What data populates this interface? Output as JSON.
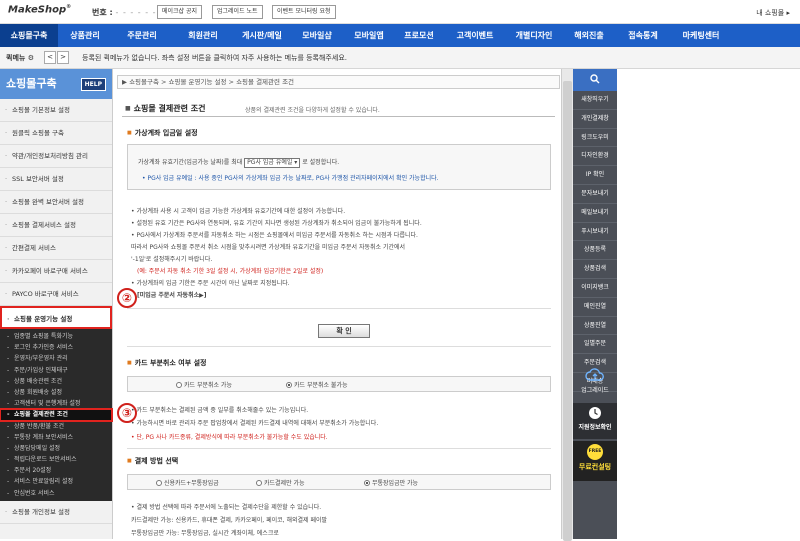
{
  "topbar": {
    "logo": "MakeShop",
    "logo_mark": "®",
    "shop_no_label": "번호 :",
    "shop_no_dots": "- - - - - - -",
    "buttons": [
      "메이크샵 공지",
      "업그레이드 노트",
      "이벤트 모니터링 요청"
    ],
    "my_mall": "내 쇼핑몰 ▸"
  },
  "nav": {
    "items": [
      "쇼핑몰구축",
      "상품관리",
      "주문관리",
      "회원관리",
      "게시판/메일",
      "모바일샵",
      "모바일앱",
      "프로모션",
      "고객이벤트",
      "개별디자인",
      "해외진출",
      "접속통계",
      "마케팅센터"
    ],
    "active_index": 0
  },
  "quickbar": {
    "label": "퀵메뉴",
    "text": "등록된 퀵메뉴가 없습니다. 좌측 설정 버튼을 클릭하여 자주 사용하는 메뉴를 등록해주세요."
  },
  "sidebar": {
    "header": "쇼핑몰구축",
    "help": "HELP",
    "items": [
      "쇼핑몰 기본정보 설정",
      "원클릭 쇼핑몰 구축",
      "약관/개인정보처리방침 관리",
      "SSL 보안서버 설정",
      "쇼핑몰 완벽 보안서버 설정",
      "쇼핑몰 결제서비스 설정",
      "간편결제 서비스",
      "카카오페이 바로구매 서비스",
      "PAYCO 바로구매 서비스",
      "쇼핑몰 운영기능 설정"
    ],
    "sub_items": [
      "업종별 쇼핑몰 특화기능",
      "로그인 추가인증 서비스",
      "운영자/부운영자 관리",
      "주문/가입상 인체태구",
      "상품 배송관련 조건",
      "상품 회원배송 설정",
      "고객센터 및 은행계좌 설정",
      "쇼핑몰 결제관련 조건",
      "상품 반품/환불 조건",
      "무통장 계좌 보안서비스",
      "상품담당메일 설정",
      "적립다운로드 보안서비스",
      "주문서 20설정",
      "서비스 만료알림리 설정",
      "안심번호 서비스"
    ],
    "active_sub_index": 7,
    "next_item": "쇼핑몰 개인정보 설정"
  },
  "breadcrumb": "▶ 쇼핑몰구축 > 쇼핑몰 운영기능 설정 > 쇼핑몰 결제관련 조건",
  "page": {
    "title": "쇼핑몰 결제관련 조건",
    "desc": "상품의 결제관련 조건을 다양하게 설정할 수 있습니다.",
    "section1": {
      "title": "가상계좌 입금일 설정",
      "line1_pre": "가상계좌 유효기간(입금가능 날짜)를 최대",
      "select_value": "PG사 입금 유예일",
      "line1_post": "로 설정합니다.",
      "note": "• PG사 입금 유예일 : 사용 중인 PG사의 가상계좌 입금 가능 날짜로, PG사 가맹점 관리자페이지에서 확인 가능합니다.",
      "bullets": [
        "• 가상계좌 사용 시 고객이 입금 가능한 가상계좌 유효기간에 대한 설정이 가능합니다.",
        "• 설정된 유효 기간은 PG사와 연동되며, 유효 기간이 지나면 생성된 가상계좌가 취소되어 입금이 불가능하게 됩니다.",
        "• PG사에서 가상계좌 주문서를 자동취소 하는 시점은 쇼핑몰에서 미입금 주문서를 자동취소 하는 시점과 다릅니다.",
        "  따라서 PG사와 쇼핑몰 주문서 취소 시점을 맞추시려면 가상계좌 유효기간을 미입금 주문서 자동취소 기간에서",
        "  '-1일'로 설정해주시기 바랍니다."
      ],
      "example": "(예: 주문서 자동 취소 기한 3일 설정 시, 가상계좌 입금기한은 2일로 설정)",
      "bullet_last": "• 가상계좌의 입금 기한은 주문 시간이 아닌 날짜로 지정됩니다.",
      "link": "[미입금 주문서 자동취소▶]"
    },
    "confirm_button": "확 인",
    "section2": {
      "title": "카드 부분취소 여부 설정",
      "options": [
        "카드 부분취소 가능",
        "카드 부분취소 불가능"
      ],
      "selected": 1,
      "bullets": [
        "• 카드 부분취소는 결제된 금액 중 일부를 취소해줄수 있는 기능입니다.",
        "• 가능하시면 바로 관리자 주문 팝업창에서 결제된 카드결제 내역에 대해서 부분취소가 가능합니다."
      ],
      "warning": "• 단, PG 사나 카드종류, 결제방식에 따라 부분취소가 불가능할 수도 있습니다."
    },
    "section3": {
      "title": "결제 방법 선택",
      "options": [
        "신용카드+무통장입금",
        "카드결제만 가능",
        "무통장입금만 가능"
      ],
      "selected": 2,
      "bullets": [
        "• 결제 방법 선택에 따라 주문서에 노출되는 결제수단을 제한할 수 있습니다.",
        "  카드결제만 가능: 신용카드, 휴대폰 결제, 카카오페이, 페이코, 해외결제 페이팔",
        "  무통장입금만 가능: 무통장입금, 실시간 계좌이체, 에스크로"
      ]
    }
  },
  "markers": [
    "②",
    "③"
  ],
  "right_panel": {
    "search_icon": "search-icon",
    "items": [
      "새창띄우기",
      "개인결제창",
      "링크도우미",
      "디자인환경",
      "IP 확인",
      "문자보내기",
      "메일보내기",
      "푸시보내기",
      "상품등록",
      "상품검색",
      "이미지뱅크",
      "메인진열",
      "상품진열",
      "일별주문",
      "주문검색",
      "미배송"
    ],
    "upgrade": "업그레이드",
    "trainee": "지원정보확인",
    "free_badge": "FREE",
    "free_label": "무료컨설팅"
  },
  "colors": {
    "nav_bg": "#1d5fc7",
    "nav_active": "#0b3f8f",
    "highlight_red": "#e0231e",
    "right_panel_bg": "#4b4f57"
  }
}
